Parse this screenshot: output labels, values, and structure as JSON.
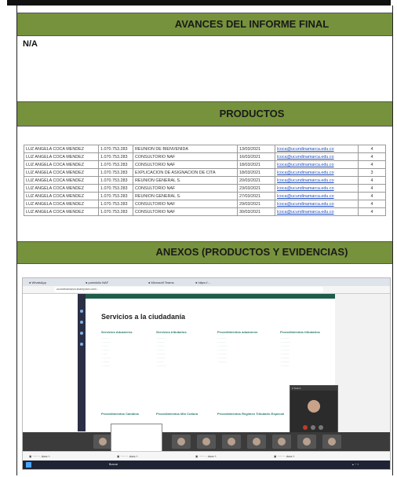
{
  "sections": {
    "avances_title": "AVANCES DEL INFORME FINAL",
    "avances_value": "N/A",
    "productos_title": "PRODUCTOS",
    "anexos_title": "ANEXOS (PRODUCTOS Y EVIDENCIAS)"
  },
  "productos": {
    "rows": [
      {
        "nombre": "LUZ ANGELA COCA MENDEZ",
        "doc": "1.070.753.283",
        "actividad": "REUNION DE BIENVENIDA",
        "fecha": "13/03/2021",
        "correo": "lcoca@ucundinamarca.edu.co",
        "cantidad": "4"
      },
      {
        "nombre": "LUZ ANGELA COCA MENDEZ",
        "doc": "1.070.753.283",
        "actividad": "CONSULTORIO NAF",
        "fecha": "16/03/2021",
        "correo": "lcoca@ucundinamarca.edu.co",
        "cantidad": "4"
      },
      {
        "nombre": "LUZ ANGELA COCA MENDEZ",
        "doc": "1.070.753.283",
        "actividad": "CONSULTORIO NAF",
        "fecha": "18/03/2021",
        "correo": "lcoca@ucundinamarca.edu.co",
        "cantidad": "4"
      },
      {
        "nombre": "LUZ ANGELA COCA MENDEZ",
        "doc": "1.070.753.283",
        "actividad": "EXPLICACION DE ASIGNACION DE CITA",
        "fecha": "18/03/2021",
        "correo": "lcoca@ucundinamarca.edu.co",
        "cantidad": "3"
      },
      {
        "nombre": "LUZ ANGELA COCA MENDEZ",
        "doc": "1.070.753.283",
        "actividad": "REUNION GENERAL S.",
        "fecha": "20/03/2021",
        "correo": "lcoca@ucundinamarca.edu.co",
        "cantidad": "4"
      },
      {
        "nombre": "LUZ ANGELA COCA MENDEZ",
        "doc": "1.070.753.283",
        "actividad": "CONSULTORIO NAF",
        "fecha": "23/03/2021",
        "correo": "lcoca@ucundinamarca.edu.co",
        "cantidad": "4"
      },
      {
        "nombre": "LUZ ANGELA COCA MENDEZ",
        "doc": "1.070.753.283",
        "actividad": "REUNION GENERAL S.",
        "fecha": "27/03/2021",
        "correo": "lcoca@ucundinamarca.edu.co",
        "cantidad": "4"
      },
      {
        "nombre": "LUZ ANGELA COCA MENDEZ",
        "doc": "1.070.753.283",
        "actividad": "CONSULTORIO NAF",
        "fecha": "29/03/2021",
        "correo": "lcoca@ucundinamarca.edu.co",
        "cantidad": "4"
      },
      {
        "nombre": "LUZ ANGELA COCA MENDEZ",
        "doc": "1.070.753.283",
        "actividad": "CONSULTORIO NAF",
        "fecha": "30/03/2021",
        "correo": "lcoca@ucundinamarca.edu.co",
        "cantidad": "4"
      }
    ]
  },
  "screenshot": {
    "page_title": "Servicios a la ciudadanía",
    "columns": [
      "Servicios Aduaneros",
      "Servicios tributarios",
      "Procedimientos aduaneros",
      "Procedimientos tributarios"
    ],
    "bottom_columns": [
      "Procedimientos Cambios",
      "Procedimientos Min Cultura",
      "Procedimientos Regimen Tributario Especial"
    ],
    "taskbar_search": "Buscar",
    "colors": {
      "band": "#76923c",
      "link": "#1f4fbf",
      "portal_green": "#2c7a6c"
    }
  }
}
